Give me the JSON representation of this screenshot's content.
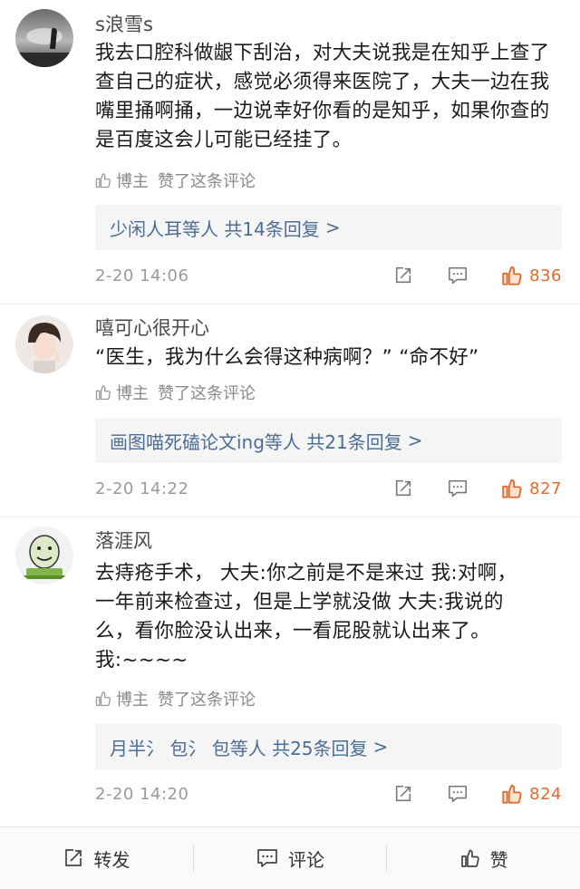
{
  "comments": [
    {
      "username": "s浪雪s",
      "text": "我去口腔科做龈下刮治，对大夫说我是在知乎上查了查自己的症状，感觉必须得来医院了，大夫一边在我嘴里捅啊捅，一边说幸好你看的是知乎，如果你查的是百度这会儿可能已经挂了。",
      "author_label": "博主",
      "liked_label": "赞了这条评论",
      "reply_summary": "少闲人耳等人 共14条回复",
      "reply_arrow": ">",
      "timestamp": "2-20 14:06",
      "like_count": "836"
    },
    {
      "username": "嘻可心很开心",
      "text": "“医生，我为什么会得这种病啊？” “命不好”",
      "author_label": "博主",
      "liked_label": "赞了这条评论",
      "reply_summary": "画图喵死磕论文ing等人 共21条回复",
      "reply_arrow": ">",
      "timestamp": "2-20 14:22",
      "like_count": "827"
    },
    {
      "username": "落涯风",
      "text_lines": [
        "去痔疮手术， 大夫:你之前是不是来过 我:对啊，",
        "一年前来检查过，但是上学就没做 大夫:我说的",
        "么，看你脸没认出来，一看屁股就认出来了。",
        "我:~~~~"
      ],
      "author_label": "博主",
      "liked_label": "赞了这条评论",
      "reply_summary": "月半氵 包氵 包等人 共25条回复",
      "reply_arrow": ">",
      "timestamp": "2-20 14:20",
      "like_count": "824"
    }
  ],
  "bottom_bar": {
    "repost_label": "转发",
    "comment_label": "评论",
    "like_label": "赞"
  },
  "colors": {
    "link_blue": "#4b6d96",
    "like_orange": "#e26a2c",
    "meta_gray": "#9a9a9a"
  }
}
